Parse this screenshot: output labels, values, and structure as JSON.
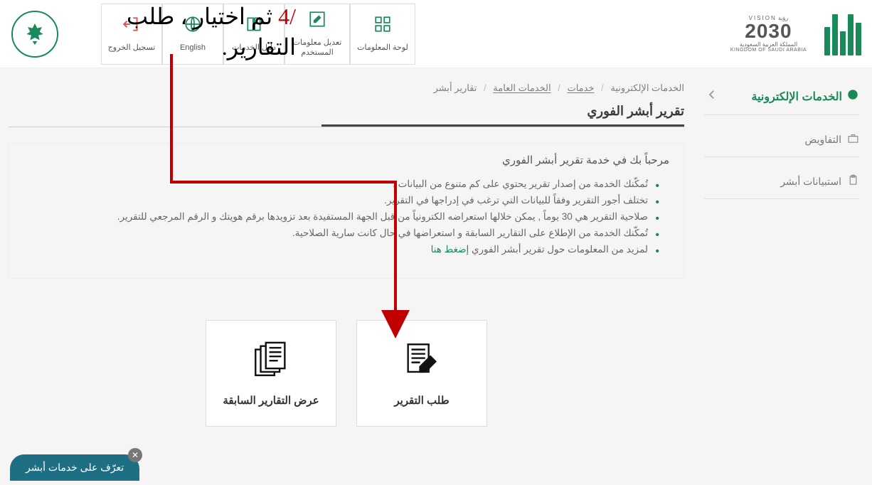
{
  "annotation": {
    "line1_num": "/4",
    "line1_rest": " ثم اختيار ، طلب",
    "line2": "التقارير."
  },
  "header": {
    "vision_small_top": "رؤية  VISION",
    "vision_big": "2030",
    "vision_small_bottom": "المملكة العربية السعودية",
    "vision_tiny": "KINGDOM OF SAUDI ARABIA",
    "nav": {
      "dashboard": "لوحة المعلومات",
      "edit_user": "تعديل معلومات المستخدم",
      "guide": "دليل الخدمات",
      "english": "English",
      "logout": "تسجيل الخروج"
    }
  },
  "sidebar": {
    "heading": "الخدمات الإلكترونية",
    "item_auth": "التفاويض",
    "item_surveys": "استبيانات أبشر"
  },
  "breadcrumb": {
    "a": "الخدمات الإلكترونية",
    "b": "خدمات",
    "c": "الخدمات العامة",
    "d": "تقارير أبشر"
  },
  "page": {
    "title": "تقرير أبشر الفوري",
    "welcome": "مرحباً بك في خدمة تقرير أبشر الفوري",
    "bullets": [
      "تُمكّنك الخدمة من إصدار تقرير يحتوي على كم متنوع من البيانات .",
      "تختلف أجور التقرير وفقاً للبيانات التي ترغب في إدراجها في التقرير.",
      "صلاحية التقرير هي 30 يوماً , يمكن خلالها استعراضه الكترونياً من قبل الجهة المستفيدة بعد تزويدها برقم هويتك و الرقم المرجعي للتقرير.",
      "تُمكّنك الخدمة من الإطلاع على التقارير السابقة و استعراضها في حال كانت سارية الصلاحية."
    ],
    "more_prefix": "لمزيد من المعلومات حول تقرير أبشر الفوري ",
    "more_link": "إضغط هنا"
  },
  "cards": {
    "request": "طلب التقرير",
    "previous": "عرض التقارير السابقة"
  },
  "help": {
    "label": "تعرّف على خدمات أبشر"
  }
}
